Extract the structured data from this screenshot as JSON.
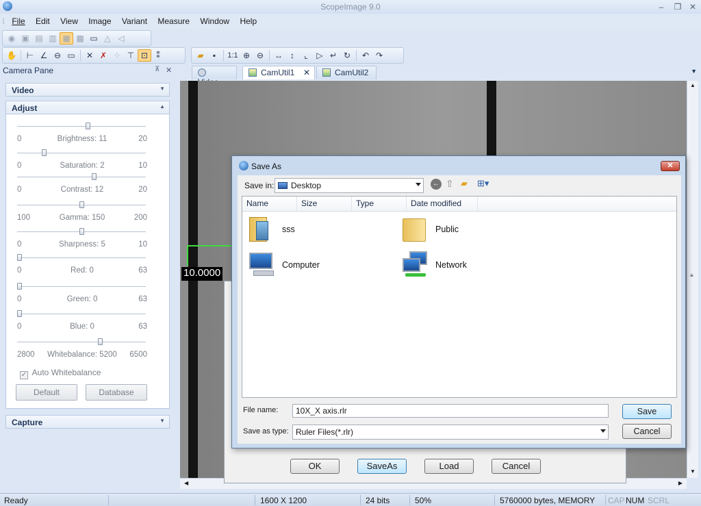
{
  "app": {
    "title": "ScopeImage 9.0",
    "window_controls": [
      "–",
      "❐",
      "✕"
    ]
  },
  "menu": [
    "File",
    "Edit",
    "View",
    "Image",
    "Variant",
    "Measure",
    "Window",
    "Help"
  ],
  "camera_pane": {
    "title": "Camera Pane",
    "pin": "⊼",
    "close": "✕",
    "sections": {
      "video": "Video",
      "adjust": "Adjust",
      "capture": "Capture"
    },
    "sliders": [
      {
        "min": "0",
        "label": "Brightness: 11",
        "max": "20",
        "level": 0.55
      },
      {
        "min": "0",
        "label": "Saturation: 2",
        "max": "10",
        "level": 0.2
      },
      {
        "min": "0",
        "label": "Contrast: 12",
        "max": "20",
        "level": 0.6
      },
      {
        "min": "100",
        "label": "Gamma: 150",
        "max": "200",
        "level": 0.5
      },
      {
        "min": "0",
        "label": "Sharpness: 5",
        "max": "10",
        "level": 0.5
      },
      {
        "min": "0",
        "label": "Red: 0",
        "max": "63",
        "level": 0
      },
      {
        "min": "0",
        "label": "Green: 0",
        "max": "63",
        "level": 0
      },
      {
        "min": "0",
        "label": "Blue: 0",
        "max": "63",
        "level": 0
      },
      {
        "min": "2800",
        "label": "Whitebalance: 5200",
        "max": "6500",
        "level": 0.65
      }
    ],
    "auto_whitebalance": {
      "label": "Auto Whitebalance",
      "checked": true
    },
    "buttons": {
      "default": "Default",
      "database": "Database"
    }
  },
  "tabs": [
    {
      "label": "Video",
      "active": false
    },
    {
      "label": "CamUtil1",
      "active": true
    },
    {
      "label": "CamUtil2",
      "active": false
    }
  ],
  "image": {
    "overlay_label": "10.0000"
  },
  "back_dialog": {
    "ok": "OK",
    "saveas": "SaveAs",
    "load": "Load",
    "cancel": "Cancel"
  },
  "save_dialog": {
    "title": "Save As",
    "save_in_label": "Save in:",
    "save_in_value": "Desktop",
    "columns": [
      "Name",
      "Size",
      "Type",
      "Date modified"
    ],
    "items": [
      {
        "name": "sss",
        "icon": "user-folder-icon"
      },
      {
        "name": "Public",
        "icon": "folder-icon"
      },
      {
        "name": "Computer",
        "icon": "computer-icon"
      },
      {
        "name": "Network",
        "icon": "network-icon"
      }
    ],
    "file_name_label": "File name:",
    "file_name_value": "10X_X axis.rlr",
    "save_as_type_label": "Save as type:",
    "save_as_type_value": "Ruler Files(*.rlr)",
    "save_button": "Save",
    "cancel_button": "Cancel"
  },
  "status": {
    "ready": "Ready",
    "resolution": "1600 X 1200",
    "bits": "24 bits",
    "zoom": "50%",
    "memory": "5760000 bytes, MEMORY",
    "cap": "CAP",
    "num": "NUM",
    "scrl": "SCRL"
  },
  "colors": {
    "accent": "#3c7fb1",
    "pane_bg": "#dce6f4"
  }
}
